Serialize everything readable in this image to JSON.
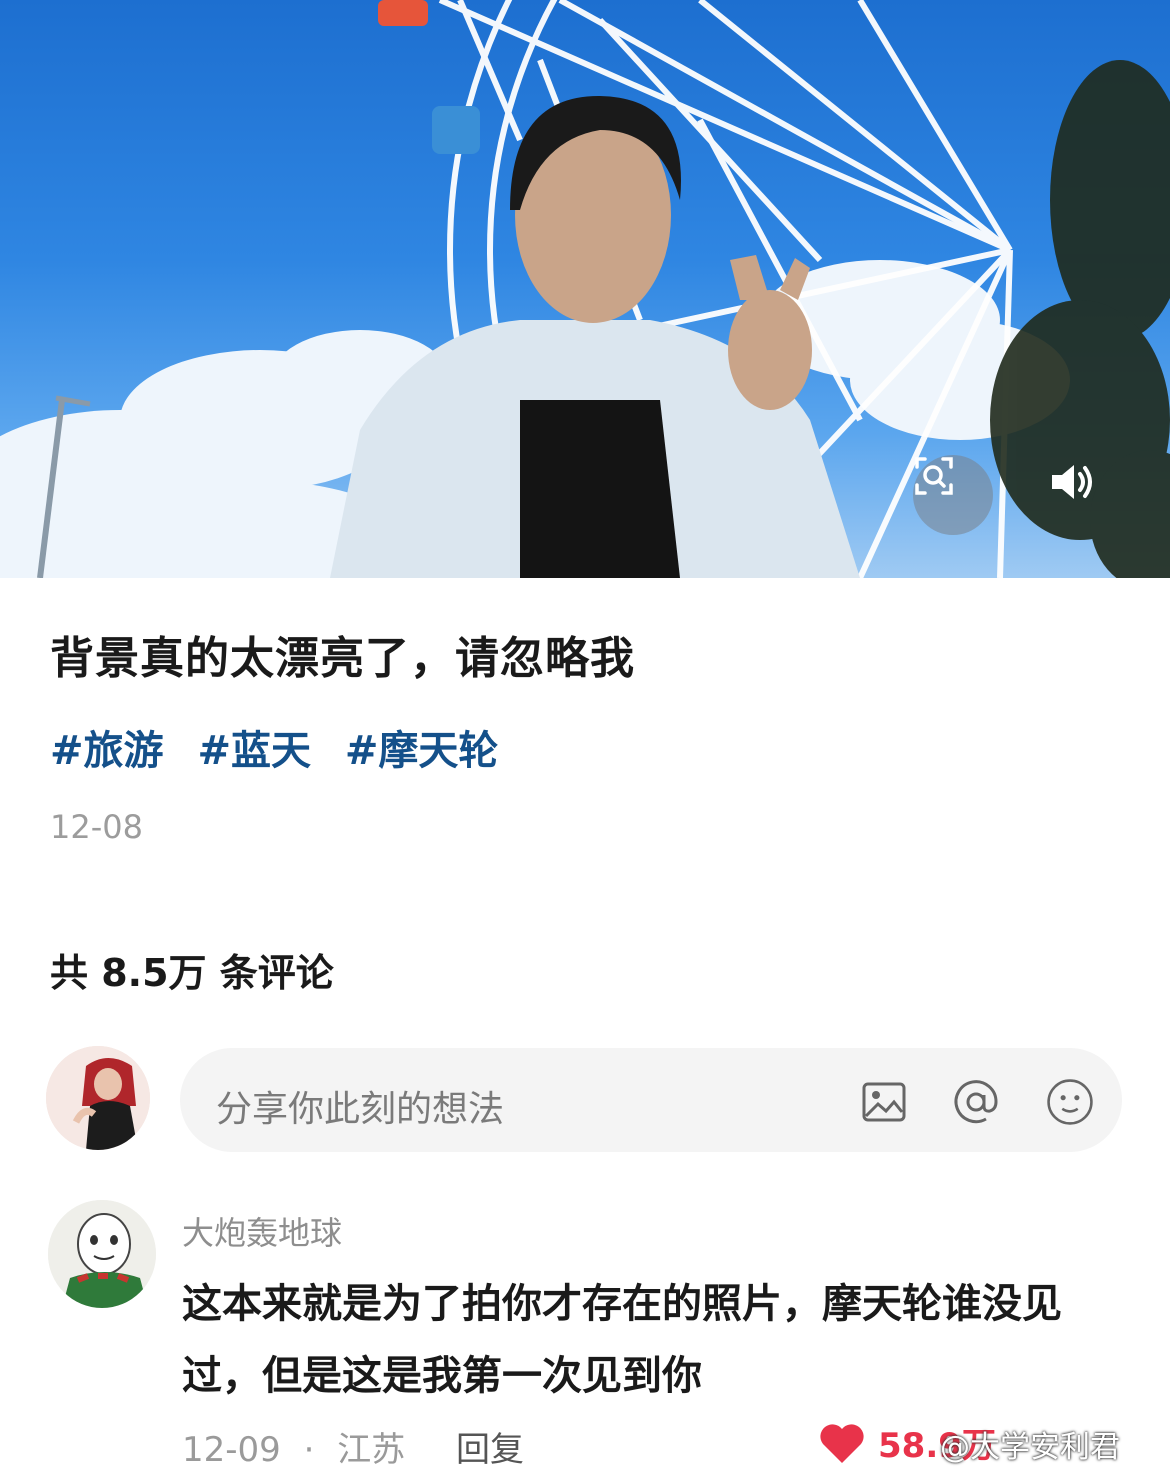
{
  "post": {
    "title": "背景真的太漂亮了，请忽略我",
    "tags": [
      "#旅游",
      "#蓝天",
      "#摩天轮"
    ],
    "date": "12-08"
  },
  "comments_header": {
    "count_text": "共 8.5万 条评论"
  },
  "comment_input": {
    "placeholder": "分享你此刻的想法",
    "icons": [
      "image-icon",
      "at-icon",
      "emoji-icon"
    ]
  },
  "comment": {
    "username": "大炮轰地球",
    "text": "这本来就是为了拍你才存在的照片，摩天轮谁没见过，但是这是我第一次见到你",
    "date": "12-09",
    "separator": "·",
    "location": "江苏",
    "reply_label": "回复",
    "likes": "58.9万"
  },
  "watermark": "@大学安利君",
  "colors": {
    "tag": "#14508a",
    "like": "#e8334a",
    "sky": "#2f86e2"
  }
}
